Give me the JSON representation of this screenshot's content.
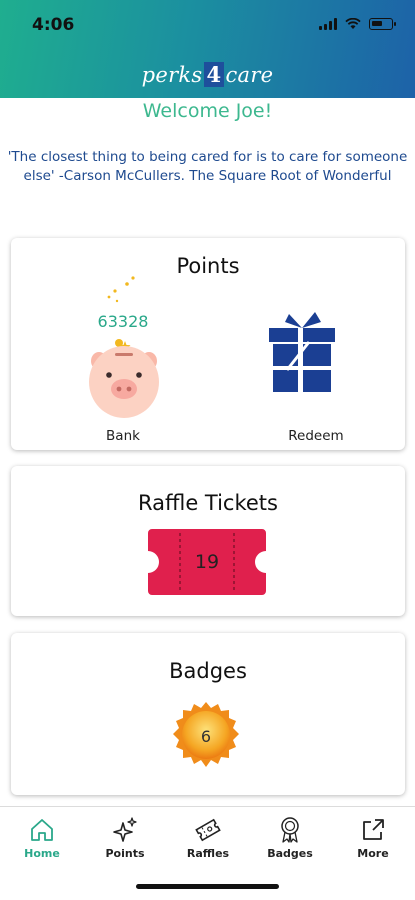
{
  "status_bar": {
    "time": "4:06"
  },
  "brand": {
    "part1": "perks",
    "part2": "4",
    "part3": "care"
  },
  "welcome": "Welcome Joe!",
  "quote": "'The closest thing to being cared for is to care for someone else' -Carson McCullers. The Square Root of Wonderful",
  "points": {
    "title": "Points",
    "bank_value": "63328",
    "bank_label": "Bank",
    "redeem_label": "Redeem"
  },
  "raffle": {
    "title": "Raffle Tickets",
    "count": "19"
  },
  "badges": {
    "title": "Badges",
    "count": "6"
  },
  "tabs": [
    {
      "label": "Home",
      "icon": "home-icon",
      "active": true
    },
    {
      "label": "Points",
      "icon": "sparkles-icon"
    },
    {
      "label": "Raffles",
      "icon": "ticket-icon"
    },
    {
      "label": "Badges",
      "icon": "badge-icon"
    },
    {
      "label": "More",
      "icon": "external-link-icon"
    }
  ],
  "colors": {
    "brand_green": "#3db88f",
    "quote_blue": "#1e4a8f",
    "gift_blue": "#1b3f93",
    "ticket_red": "#e0204d",
    "badge_gold": "#f2a51f"
  }
}
